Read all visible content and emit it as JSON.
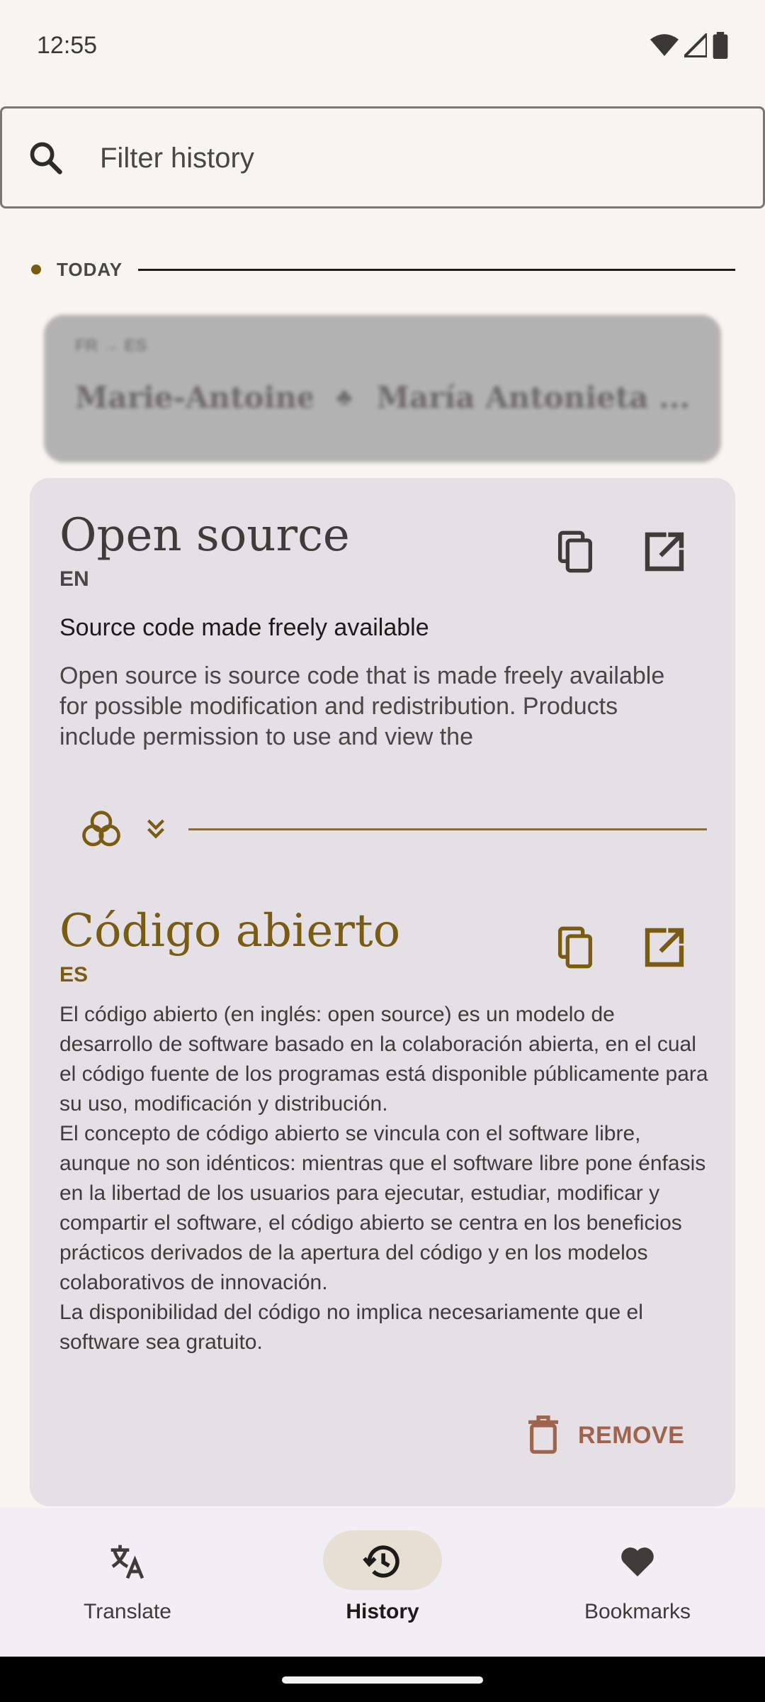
{
  "status_bar": {
    "time": "12:55"
  },
  "search": {
    "placeholder": "Filter history"
  },
  "section": {
    "label": "TODAY"
  },
  "blurred_item": {
    "langs": "FR → ES",
    "source": "Marie-Antoinett...",
    "target": "María Antonieta ..."
  },
  "card": {
    "source": {
      "title": "Open source",
      "lang": "EN",
      "description": "Source code made freely available",
      "extract": "Open source is source code that is made freely available for possible modification and redistribution. Products include permission to use and view the"
    },
    "target": {
      "title": "Código abierto",
      "lang": "ES",
      "extract_paragraphs": [
        "El código abierto (en inglés: open source) es un modelo de desarrollo de software basado en la colaboración abierta, en el cual el código fuente de los programas está disponible públicamente para su uso, modificación y distribución.",
        "El concepto de código abierto se vincula con el software libre, aunque no son idénticos: mientras que el software libre pone énfasis en la libertad de los usuarios para ejecutar, estudiar, modificar y compartir el software, el código abierto se centra en los beneficios prácticos derivados de la apertura del código y en los modelos colaborativos de innovación.",
        "La disponibilidad del código no implica necesariamente que el software sea gratuito."
      ]
    },
    "remove_label": "REMOVE"
  },
  "nav": {
    "items": [
      {
        "label": "Translate",
        "icon": "translate-icon",
        "active": false
      },
      {
        "label": "History",
        "icon": "history-icon",
        "active": true
      },
      {
        "label": "Bookmarks",
        "icon": "heart-icon",
        "active": false
      }
    ]
  },
  "colors": {
    "accent": "#7a5b12",
    "remove": "#a0644c",
    "card_bg": "#e5e0e6",
    "nav_bg": "#f1eef6"
  }
}
